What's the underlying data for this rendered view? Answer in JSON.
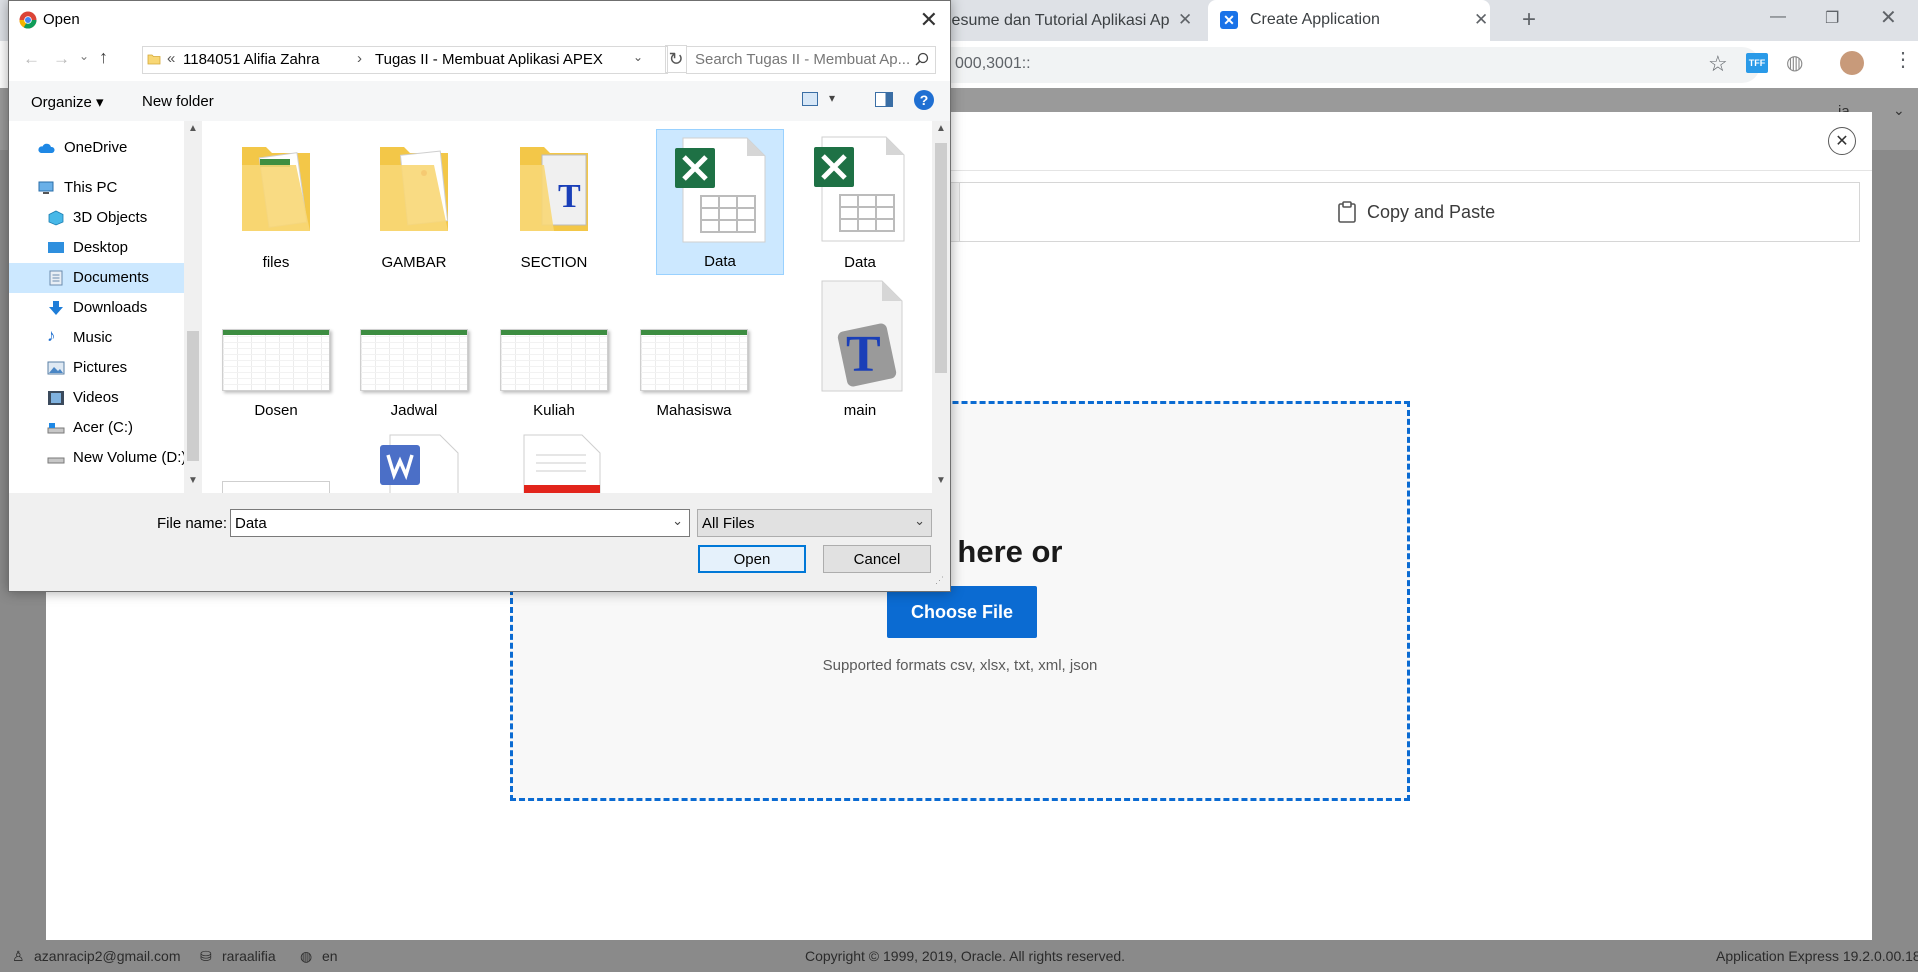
{
  "browser": {
    "tabs": [
      {
        "title": "Resume dan Tutorial Aplikasi Ape"
      },
      {
        "title": "Create Application"
      }
    ],
    "address_partial": "000,3001::"
  },
  "apex": {
    "tabs": {
      "copy_paste": "Copy and Paste"
    },
    "dropzone": {
      "drop_text": "op file here or",
      "choose_file": "Choose File",
      "formats": "Supported formats csv, xlsx, txt, xml, json"
    },
    "footer": {
      "user": "azanracip2@gmail.com",
      "workspace": "raraalifia",
      "language": "en",
      "copyright": "Copyright © 1999, 2019, Oracle. All rights reserved.",
      "version": "Application Express 19.2.0.00.18"
    },
    "header_partial": "ia"
  },
  "dialog": {
    "title": "Open",
    "breadcrumb": {
      "prefix": "«",
      "parent": "1184051 Alifia Zahra",
      "current": "Tugas II - Membuat Aplikasi APEX"
    },
    "search_placeholder": "Search Tugas II - Membuat Ap...",
    "toolbar": {
      "organize": "Organize",
      "new_folder": "New folder"
    },
    "nav": [
      {
        "label": "OneDrive",
        "icon": "cloud-icon"
      },
      {
        "label": "This PC",
        "icon": "computer-icon"
      },
      {
        "label": "3D Objects",
        "icon": "cube-icon"
      },
      {
        "label": "Desktop",
        "icon": "desktop-icon"
      },
      {
        "label": "Documents",
        "icon": "document-icon",
        "selected": true
      },
      {
        "label": "Downloads",
        "icon": "download-icon"
      },
      {
        "label": "Music",
        "icon": "music-icon"
      },
      {
        "label": "Pictures",
        "icon": "picture-icon"
      },
      {
        "label": "Videos",
        "icon": "video-icon"
      },
      {
        "label": "Acer (C:)",
        "icon": "drive-icon"
      },
      {
        "label": "New Volume (D:)",
        "icon": "drive-icon"
      }
    ],
    "files": [
      {
        "name": "files",
        "type": "folder"
      },
      {
        "name": "GAMBAR",
        "type": "folder"
      },
      {
        "name": "SECTION",
        "type": "folder"
      },
      {
        "name": "Data",
        "type": "excel",
        "selected": true
      },
      {
        "name": "Data",
        "type": "excel"
      },
      {
        "name": "Dosen",
        "type": "spreadsheet"
      },
      {
        "name": "Jadwal",
        "type": "spreadsheet"
      },
      {
        "name": "Kuliah",
        "type": "spreadsheet"
      },
      {
        "name": "Mahasiswa",
        "type": "spreadsheet"
      },
      {
        "name": "main",
        "type": "tex"
      }
    ],
    "file_name_label": "File name:",
    "file_name_value": "Data",
    "file_type": "All Files",
    "open_button": "Open",
    "cancel_button": "Cancel"
  },
  "colors": {
    "apex_blue": "#0b6bd2",
    "selection": "#cce8ff",
    "excel_green": "#1e7145"
  }
}
